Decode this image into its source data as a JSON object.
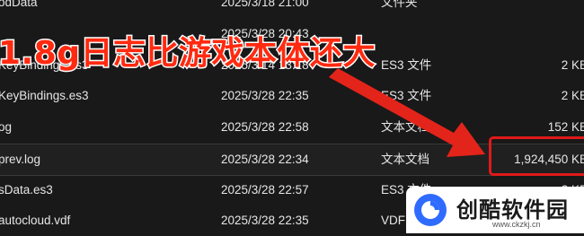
{
  "files": [
    {
      "name": "odData",
      "date": "2025/3/18 21:00",
      "type": "文件夹",
      "size": ""
    },
    {
      "name": "",
      "date": "2025/3/28 20:43",
      "type": "",
      "size": ""
    },
    {
      "name": "KeyBindings.es3",
      "date": "2025/3/14 13:18",
      "type": "ES3 文件",
      "size": "2 KB"
    },
    {
      "name": "KeyBindings.es3",
      "date": "2025/3/28 22:35",
      "type": "ES3 文件",
      "size": "2 KB"
    },
    {
      "name": "og",
      "date": "2025/3/28 22:58",
      "type": "文本文档",
      "size": "152 KB"
    },
    {
      "name": "prev.log",
      "date": "2025/3/28 22:34",
      "type": "文本文档",
      "size": "1,924,450 KB"
    },
    {
      "name": "sData.es3",
      "date": "2025/3/28 22:57",
      "type": "ES3 文件",
      "size": "2 KB"
    },
    {
      "name": "autocloud.vdf",
      "date": "2025/3/28 22:35",
      "type": "VDF",
      "size": ""
    }
  ],
  "annotation": {
    "text": "1.8g日志比游戏本体还大",
    "color": "#ff2a10"
  },
  "watermark": {
    "brand": "创酷软件园",
    "url": "www.ckzkj.cn"
  }
}
